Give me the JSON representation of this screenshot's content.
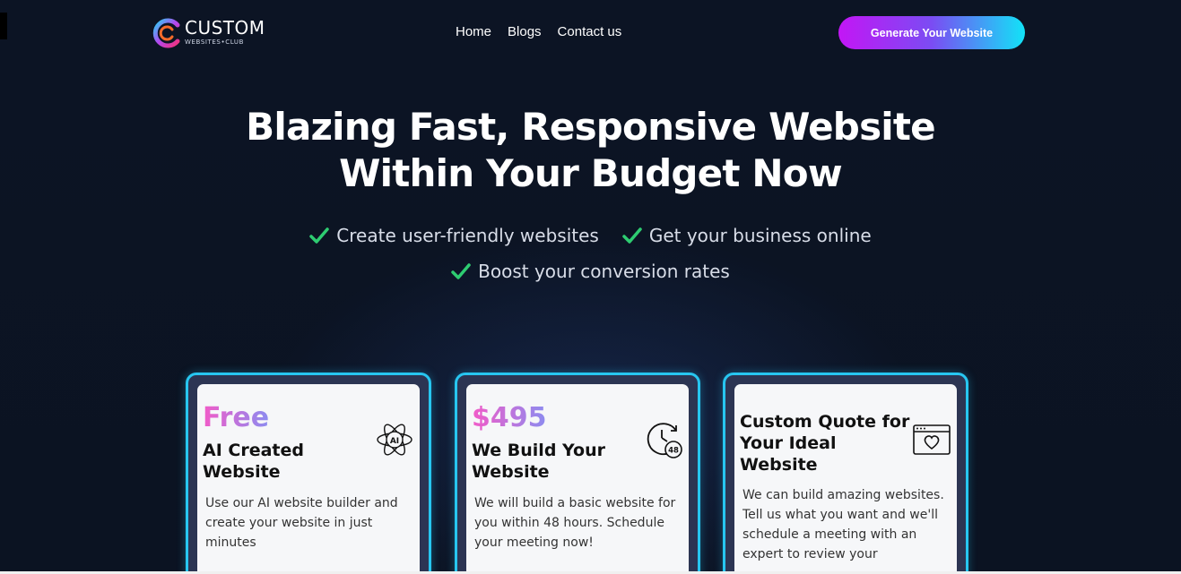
{
  "header": {
    "logo_main": "CUSTOM",
    "logo_sub": "WEBSITES•CLUB",
    "nav": [
      "Home",
      "Blogs",
      "Contact us"
    ],
    "cta_label": "Generate Your Website"
  },
  "hero": {
    "title_line1": "Blazing Fast, Responsive Website",
    "title_line2": "Within Your Budget Now",
    "features": [
      "Create user-friendly websites",
      "Get your business online",
      "Boost your conversion rates"
    ]
  },
  "cards": [
    {
      "price": "Free",
      "heading": "AI Created Website",
      "icon": "ai-icon",
      "description": "Use our AI website builder and create your website in just minutes"
    },
    {
      "price": "$495",
      "heading": "We Build Your Website",
      "icon": "clock-48-icon",
      "description": "We will build a basic website for you within 48 hours.  Schedule your meeting now!"
    },
    {
      "price": "",
      "heading": "Custom Quote for Your Ideal Website",
      "icon": "browser-heart-icon",
      "description": "We can build amazing websites. Tell us what you want and we'll schedule a meeting with an expert to review your"
    }
  ],
  "colors": {
    "background": "#0c1424",
    "accent_cyan": "#27c6f0",
    "check_green": "#2ecc71",
    "cta_gradient_start": "#c316f5",
    "cta_gradient_end": "#12e3f7"
  }
}
